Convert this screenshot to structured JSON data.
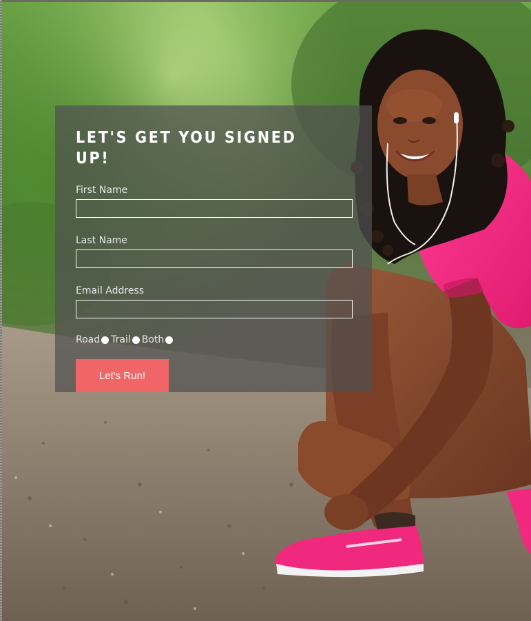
{
  "form": {
    "title": "LET'S GET YOU SIGNED UP!",
    "fields": [
      {
        "label": "First Name",
        "value": ""
      },
      {
        "label": "Last Name",
        "value": ""
      },
      {
        "label": "Email Address",
        "value": ""
      }
    ],
    "radio_options": [
      {
        "label": "Road"
      },
      {
        "label": "Trail"
      },
      {
        "label": "Both"
      }
    ],
    "submit_label": "Let's Run!"
  },
  "colors": {
    "panel_overlay": "#505050",
    "button": "#f06666",
    "shirt": "#f0287e",
    "shoe": "#f0287e"
  }
}
